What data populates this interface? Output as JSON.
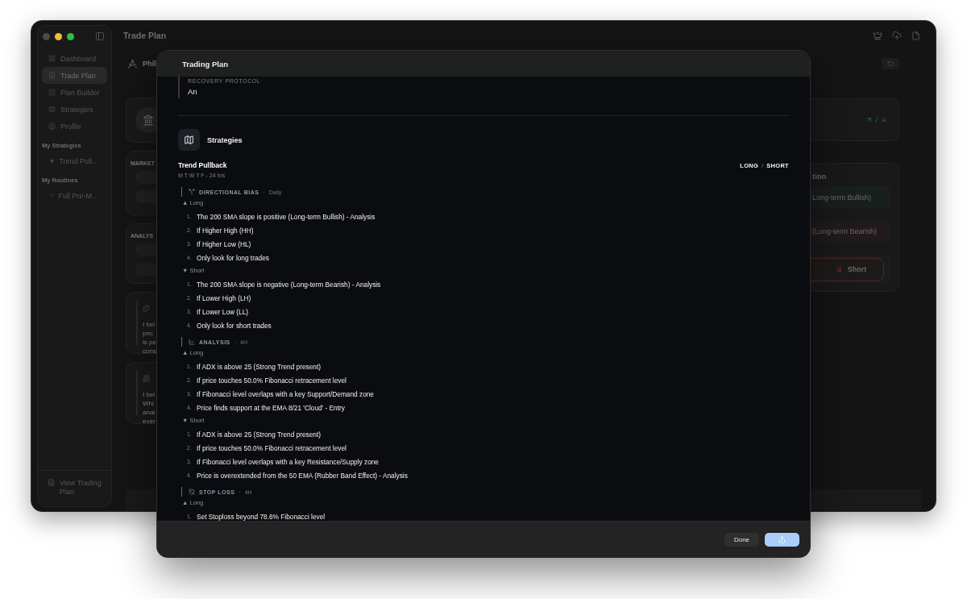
{
  "window": {
    "title": "Trade Plan"
  },
  "sidebar": {
    "items": [
      {
        "label": "Dashboard",
        "selected": false
      },
      {
        "label": "Trade Plan",
        "selected": true
      },
      {
        "label": "Plan Builder",
        "selected": false
      },
      {
        "label": "Strategies",
        "selected": false
      },
      {
        "label": "Profile",
        "selected": false
      }
    ],
    "sections": [
      {
        "title": "My Strategies",
        "items": [
          {
            "label": "Trend Pull…",
            "selected": false
          }
        ]
      },
      {
        "title": "My Routines",
        "items": [
          {
            "label": "Full Pre-M…",
            "selected": false
          }
        ]
      }
    ],
    "footer": {
      "label": "View Trading Plan"
    }
  },
  "main": {
    "header": {
      "title": "Phil"
    },
    "market_card": {
      "label": "MARKET"
    },
    "analysis_card": {
      "label": "ANALYS"
    },
    "notes": [
      {
        "text": "I bel\npric\nis pe\ncons"
      },
      {
        "text": "I bel\nWhi\nanal\never"
      }
    ],
    "bias_card": {
      "separator": "/"
    },
    "direction_card": {
      "title": "tion",
      "options": [
        {
          "kind": "long",
          "text": "Long-term Bullish)"
        },
        {
          "kind": "short",
          "text": "(Long-term Bearish)"
        }
      ],
      "button": {
        "label": "Short"
      }
    }
  },
  "modal": {
    "title": "Trading Plan",
    "recovery": {
      "label": "RECOVERY PROTOCOL",
      "value": "An"
    },
    "strategies": {
      "title": "Strategies",
      "items": [
        {
          "name": "Trend Pullback",
          "schedule": "M T W T F - 24 hrs",
          "sides": [
            "LONG",
            "SHORT"
          ],
          "separator": "/",
          "sections": [
            {
              "label": "DIRECTIONAL BIAS",
              "separator": "·",
              "timeframe": "Daily",
              "groups": [
                {
                  "label": "▲ Long",
                  "rules": [
                    {
                      "number": "1.",
                      "text": "The 200 SMA slope is positive (Long-term Bullish) - Analysis"
                    },
                    {
                      "number": "2.",
                      "text": "If Higher High (HH)"
                    },
                    {
                      "number": "3.",
                      "text": "If Higher Low (HL)"
                    },
                    {
                      "number": "4.",
                      "text": "Only look for long trades"
                    }
                  ]
                },
                {
                  "label": "▼ Short",
                  "rules": [
                    {
                      "number": "1.",
                      "text": "The 200 SMA slope is negative (Long-term Bearish) - Analysis"
                    },
                    {
                      "number": "2.",
                      "text": "If Lower High (LH)"
                    },
                    {
                      "number": "3.",
                      "text": "If Lower Low (LL)"
                    },
                    {
                      "number": "4.",
                      "text": "Only look for short trades"
                    }
                  ]
                }
              ]
            },
            {
              "label": "ANALYSIS",
              "separator": "·",
              "timeframe": "4H",
              "groups": [
                {
                  "label": "▲ Long",
                  "rules": [
                    {
                      "number": "1.",
                      "text": "If ADX is above 25 (Strong Trend present)"
                    },
                    {
                      "number": "2.",
                      "text": "If price touches 50.0% Fibonacci retracement level"
                    },
                    {
                      "number": "3.",
                      "text": "If Fibonacci level overlaps with a key Support/Demand zone"
                    },
                    {
                      "number": "4.",
                      "text": "Price finds support at the EMA 8/21 'Cloud' - Entry"
                    }
                  ]
                },
                {
                  "label": "▼ Short",
                  "rules": [
                    {
                      "number": "1.",
                      "text": "If ADX is above 25 (Strong Trend present)"
                    },
                    {
                      "number": "2.",
                      "text": "If price touches 50.0% Fibonacci retracement level"
                    },
                    {
                      "number": "3.",
                      "text": "If Fibonacci level overlaps with a key Resistance/Supply zone"
                    },
                    {
                      "number": "4.",
                      "text": "Price is overextended from the 50 EMA (Rubber Band Effect) - Analysis"
                    }
                  ]
                }
              ]
            },
            {
              "label": "STOP LOSS",
              "separator": "·",
              "timeframe": "4H",
              "groups": [
                {
                  "label": "▲ Long",
                  "rules": [
                    {
                      "number": "1.",
                      "text": "Set Stoploss beyond 78.6% Fibonacci level"
                    }
                  ]
                }
              ]
            }
          ]
        }
      ]
    },
    "buttons": {
      "done": "Done"
    }
  }
}
